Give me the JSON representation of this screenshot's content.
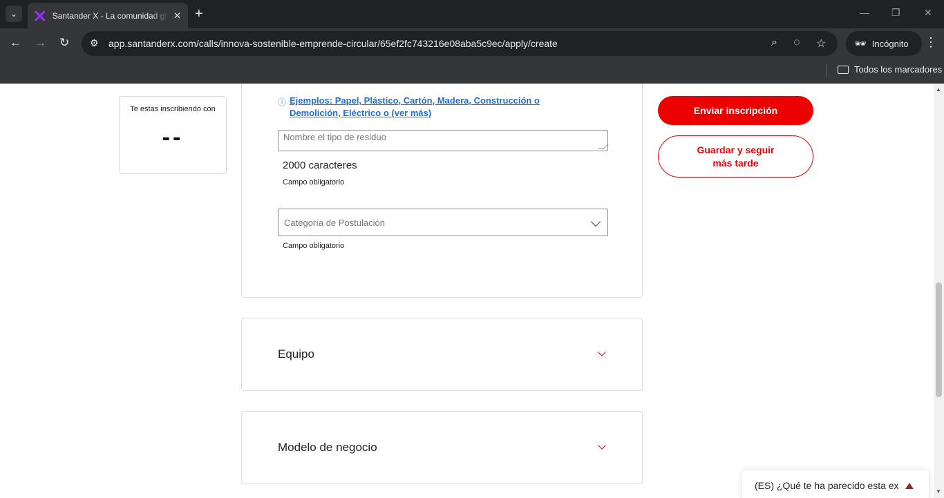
{
  "browser": {
    "tab_title": "Santander X - La comunidad global de emprendimiento",
    "url": "app.santanderx.com/calls/innova-sostenible-emprende-circular/65ef2fc743216e08aba5c9ec/apply/create",
    "incognito_label": "Incógnito",
    "bookmarks_label": "Todos los marcadores"
  },
  "sidebar": {
    "enroll_label": "Te estas inscribiendo con",
    "enroll_value": "--"
  },
  "form": {
    "examples_link": "Ejemplos: Papel, Plástico, Cartón, Madera, Construcción o Demolición, Eléctrico o (ver más)",
    "residue_placeholder": "Nombre el tipo de residuo",
    "char_counter": "2000 caracteres",
    "required_1": "Campo obligatorio",
    "category_placeholder": "Categoría de Postulación",
    "required_2": "Campo obligatorio"
  },
  "accordions": [
    {
      "title": "Equipo"
    },
    {
      "title": "Modelo de negocio"
    }
  ],
  "actions": {
    "send_label": "Enviar inscripción",
    "save_label": "Guardar y seguir más tarde"
  },
  "survey": {
    "text": "(ES) ¿Qué te ha parecido esta experiencia?"
  },
  "colors": {
    "brand_red": "#ec0000",
    "link_blue": "#1f6fd1",
    "chrome_dark": "#202124"
  }
}
